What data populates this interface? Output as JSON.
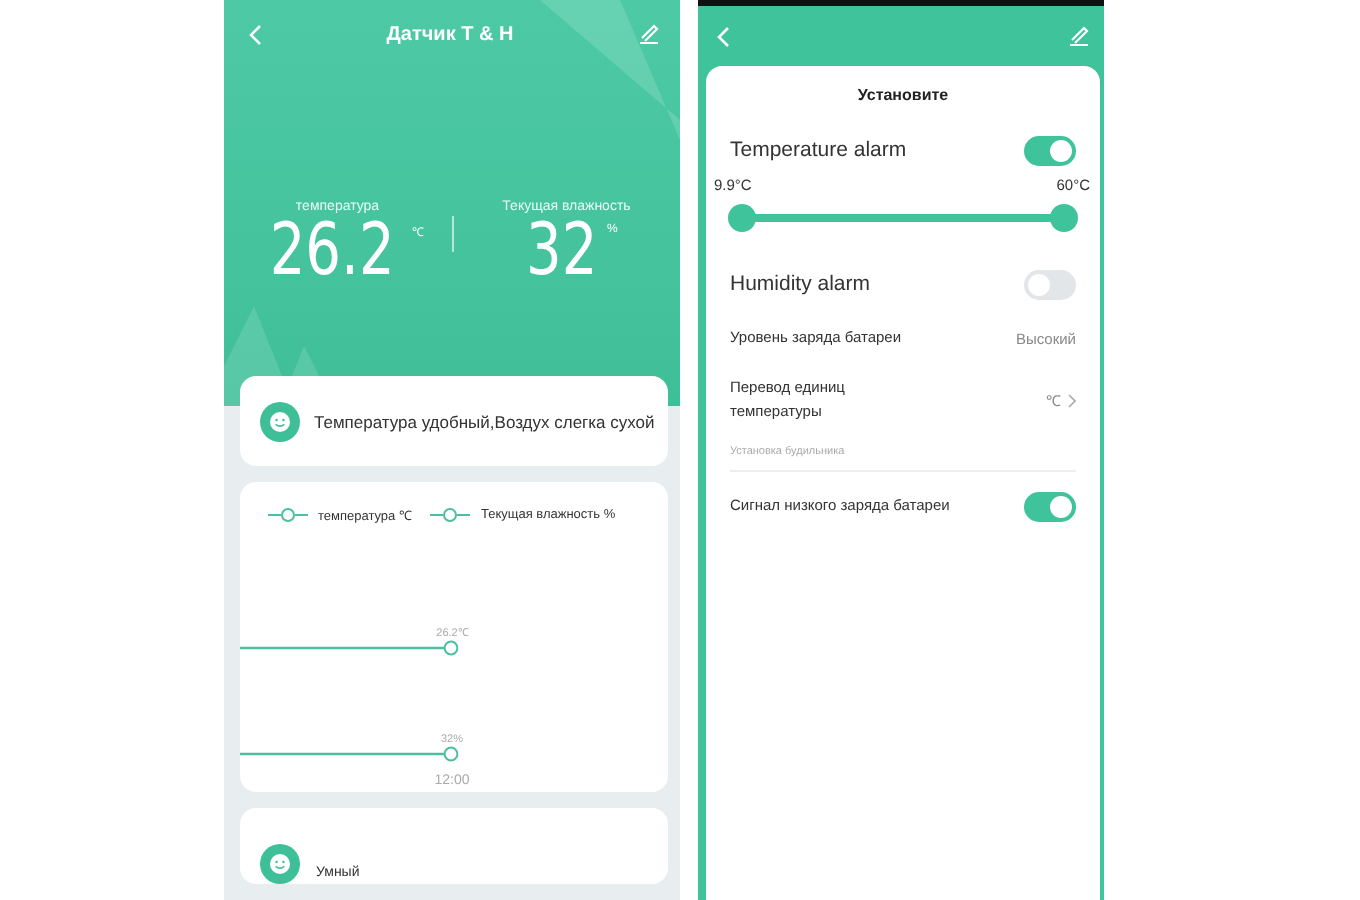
{
  "left_screen": {
    "header": {
      "title": "Датчик T & H"
    },
    "readings": [
      {
        "label": "температура",
        "value": "26.2",
        "unit": "℃"
      },
      {
        "label": "Текущая влажность",
        "value": "32",
        "unit": "%"
      }
    ],
    "status_card": {
      "text": "Температура удобный,Воздух слегка сухой"
    },
    "chart": {
      "legend": [
        "температура ℃",
        "Текущая влажность %"
      ],
      "point_labels": [
        "26.2℃",
        "32%"
      ],
      "time_label": "12:00"
    },
    "bottom_card": {
      "text": "Умный"
    }
  },
  "right_screen": {
    "card_title": "Установите",
    "temperature_alarm": {
      "label": "Temperature alarm",
      "on": true
    },
    "range": {
      "low": {
        "label": "9.9°C",
        "level": 0
      },
      "high": {
        "label": "60°C",
        "level": 1
      }
    },
    "humidity_alarm": {
      "label": "Humidity alarm",
      "on": false
    },
    "battery_level": {
      "label": "Уровень заряда батареи",
      "value": "Высокий"
    },
    "unit_conversion": {
      "label": "Перевод единиц температуры",
      "value": "℃"
    },
    "section_label": "Установка будильника",
    "low_battery_signal": {
      "label": "Сигнал низкого заряда батареи",
      "on": true
    }
  }
}
